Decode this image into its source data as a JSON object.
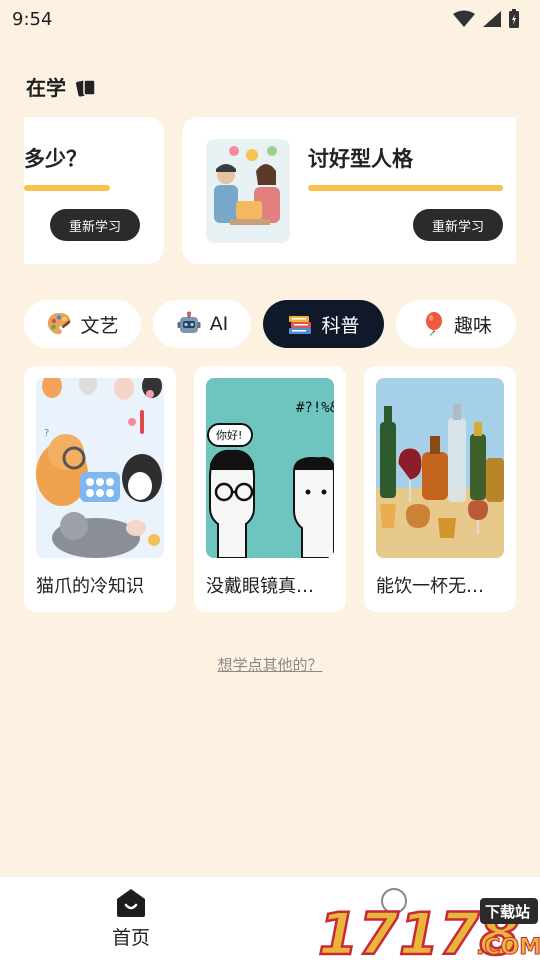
{
  "status": {
    "time": "9:54"
  },
  "section": {
    "title": "在学"
  },
  "learning": [
    {
      "title": "多少？",
      "progress": 1.0,
      "action": "重新学习"
    },
    {
      "title": "讨好型人格",
      "progress": 1.0,
      "action": "重新学习"
    }
  ],
  "categories": [
    {
      "label": "文艺",
      "icon": "palette-icon",
      "active": false
    },
    {
      "label": "AI",
      "icon": "robot-icon",
      "active": false
    },
    {
      "label": "科普",
      "icon": "books-icon",
      "active": true
    },
    {
      "label": "趣味",
      "icon": "balloon-icon",
      "active": false
    }
  ],
  "topics": [
    {
      "title": "猫爪的冷知识"
    },
    {
      "title": "没戴眼镜真…"
    },
    {
      "title": "能饮一杯无…"
    }
  ],
  "comic": {
    "bubble": "你好!",
    "symbols": "#?!%&"
  },
  "more_link": "想学点其他的？",
  "nav": {
    "home": "首页"
  },
  "watermark": {
    "digits": "17178",
    "badge": "下载站",
    "domain": ".COM"
  },
  "colors": {
    "background": "#FDF1E1",
    "progress": "#F7C24E",
    "active_chip": "#10192A",
    "button": "#2B2B2B"
  }
}
